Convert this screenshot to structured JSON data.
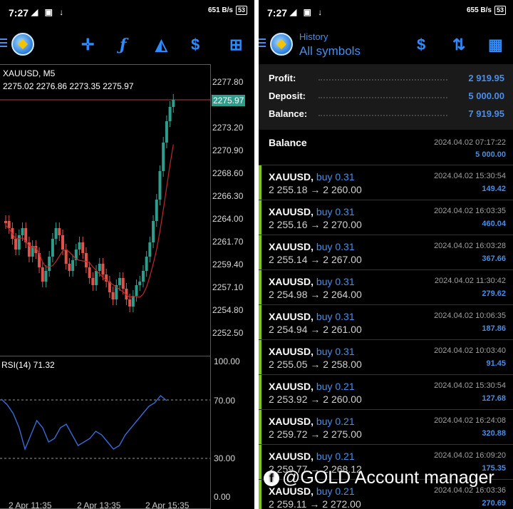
{
  "left": {
    "status": {
      "time": "7:27",
      "icons": "◢ ▣ ↓",
      "net": "651 B/s",
      "battery": "53"
    },
    "chart": {
      "symbol_tf": "XAUUSD, M5",
      "ohlc": "2275.02 2276.86 2273.35 2275.97",
      "current_price": "2275.97",
      "price_labels": [
        "2277.80",
        "2273.20",
        "2270.90",
        "2268.60",
        "2266.30",
        "2264.00",
        "2261.70",
        "2259.40",
        "2257.10",
        "2254.80",
        "2252.50"
      ],
      "rsi_label": "RSI(14) 71.32",
      "rsi_levels": [
        "100.00",
        "70.00",
        "30.00",
        "0.00"
      ],
      "x_labels": [
        "2 Apr 11:35",
        "2 Apr 13:35",
        "2 Apr 15:35"
      ]
    }
  },
  "right": {
    "status": {
      "time": "7:27",
      "icons": "◢ ▣ ↓",
      "net": "655 B/s",
      "battery": "53"
    },
    "header": {
      "title": "History",
      "subtitle": "All symbols"
    },
    "summary": {
      "profit_label": "Profit:",
      "profit": "2 919.95",
      "deposit_label": "Deposit:",
      "deposit": "5 000.00",
      "balance_label": "Balance:",
      "balance": "7 919.95"
    },
    "balance_row": {
      "title": "Balance",
      "date": "2024.04.02 07:17:22",
      "value": "5 000.00"
    },
    "deals": [
      {
        "symbol": "XAUUSD,",
        "side": "buy 0.31",
        "prices": "2 255.18 → 2 260.00",
        "date": "2024.04.02 15:30:54",
        "profit": "149.42"
      },
      {
        "symbol": "XAUUSD,",
        "side": "buy 0.31",
        "prices": "2 255.16 → 2 270.00",
        "date": "2024.04.02 16:03:35",
        "profit": "460.04"
      },
      {
        "symbol": "XAUUSD,",
        "side": "buy 0.31",
        "prices": "2 255.14 → 2 267.00",
        "date": "2024.04.02 16:03:28",
        "profit": "367.66"
      },
      {
        "symbol": "XAUUSD,",
        "side": "buy 0.31",
        "prices": "2 254.98 → 2 264.00",
        "date": "2024.04.02 11:30:42",
        "profit": "279.62"
      },
      {
        "symbol": "XAUUSD,",
        "side": "buy 0.31",
        "prices": "2 254.94 → 2 261.00",
        "date": "2024.04.02 10:06:35",
        "profit": "187.86"
      },
      {
        "symbol": "XAUUSD,",
        "side": "buy 0.31",
        "prices": "2 255.05 → 2 258.00",
        "date": "2024.04.02 10:03:40",
        "profit": "91.45"
      },
      {
        "symbol": "XAUUSD,",
        "side": "buy 0.21",
        "prices": "2 253.92 → 2 260.00",
        "date": "2024.04.02 15:30:54",
        "profit": "127.68"
      },
      {
        "symbol": "XAUUSD,",
        "side": "buy 0.21",
        "prices": "2 259.72 → 2 275.00",
        "date": "2024.04.02 16:24:08",
        "profit": "320.88"
      },
      {
        "symbol": "XAUUSD,",
        "side": "buy 0.21",
        "prices": "2 259.77 → 2 268.12",
        "date": "2024.04.02 16:09:20",
        "profit": "175.35"
      },
      {
        "symbol": "XAUUSD,",
        "side": "buy 0.21",
        "prices": "2 259.11 → 2 272.00",
        "date": "2024.04.02 16:03:36",
        "profit": "270.69"
      }
    ]
  },
  "watermark": "@GOLD Account manager",
  "colors": {
    "accent": "#4a8de8",
    "bull": "#2e9e8c",
    "bear": "#e0524a",
    "ma": "#c0282a",
    "rsi": "#3a6ad4",
    "win_bar": "#7fc81a"
  }
}
